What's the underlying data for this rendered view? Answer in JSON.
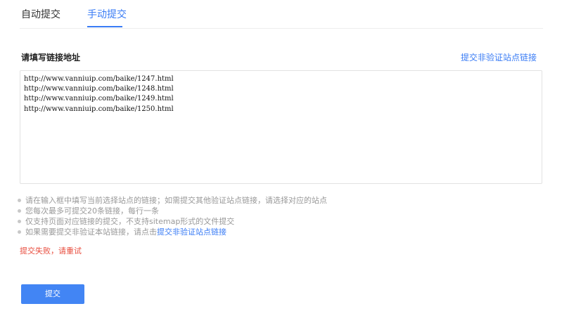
{
  "tabs": [
    {
      "label": "自动提交",
      "active": false
    },
    {
      "label": "手动提交",
      "active": true
    }
  ],
  "form": {
    "title": "请填写链接地址",
    "side_link": "提交非验证站点链接",
    "urls": "http://www.vanniuip.com/baike/1247.html\nhttp://www.vanniuip.com/baike/1248.html\nhttp://www.vanniuip.com/baike/1249.html\nhttp://www.vanniuip.com/baike/1250.html"
  },
  "tips": [
    "请在输入框中填写当前选择站点的链接；如需提交其他验证站点链接，请选择对应的站点",
    "您每次最多可提交20条链接，每行一条",
    "仅支持页面对应链接的提交，不支持sitemap形式的文件提交"
  ],
  "tip_with_link": {
    "text": "如果需要提交非验证本站链接，请点击",
    "link": "提交非验证站点链接"
  },
  "error": "提交失败，请重试",
  "submit_label": "提交",
  "colors": {
    "accent": "#3a7cf5",
    "button": "#4285f4",
    "error": "#e84c3d"
  }
}
